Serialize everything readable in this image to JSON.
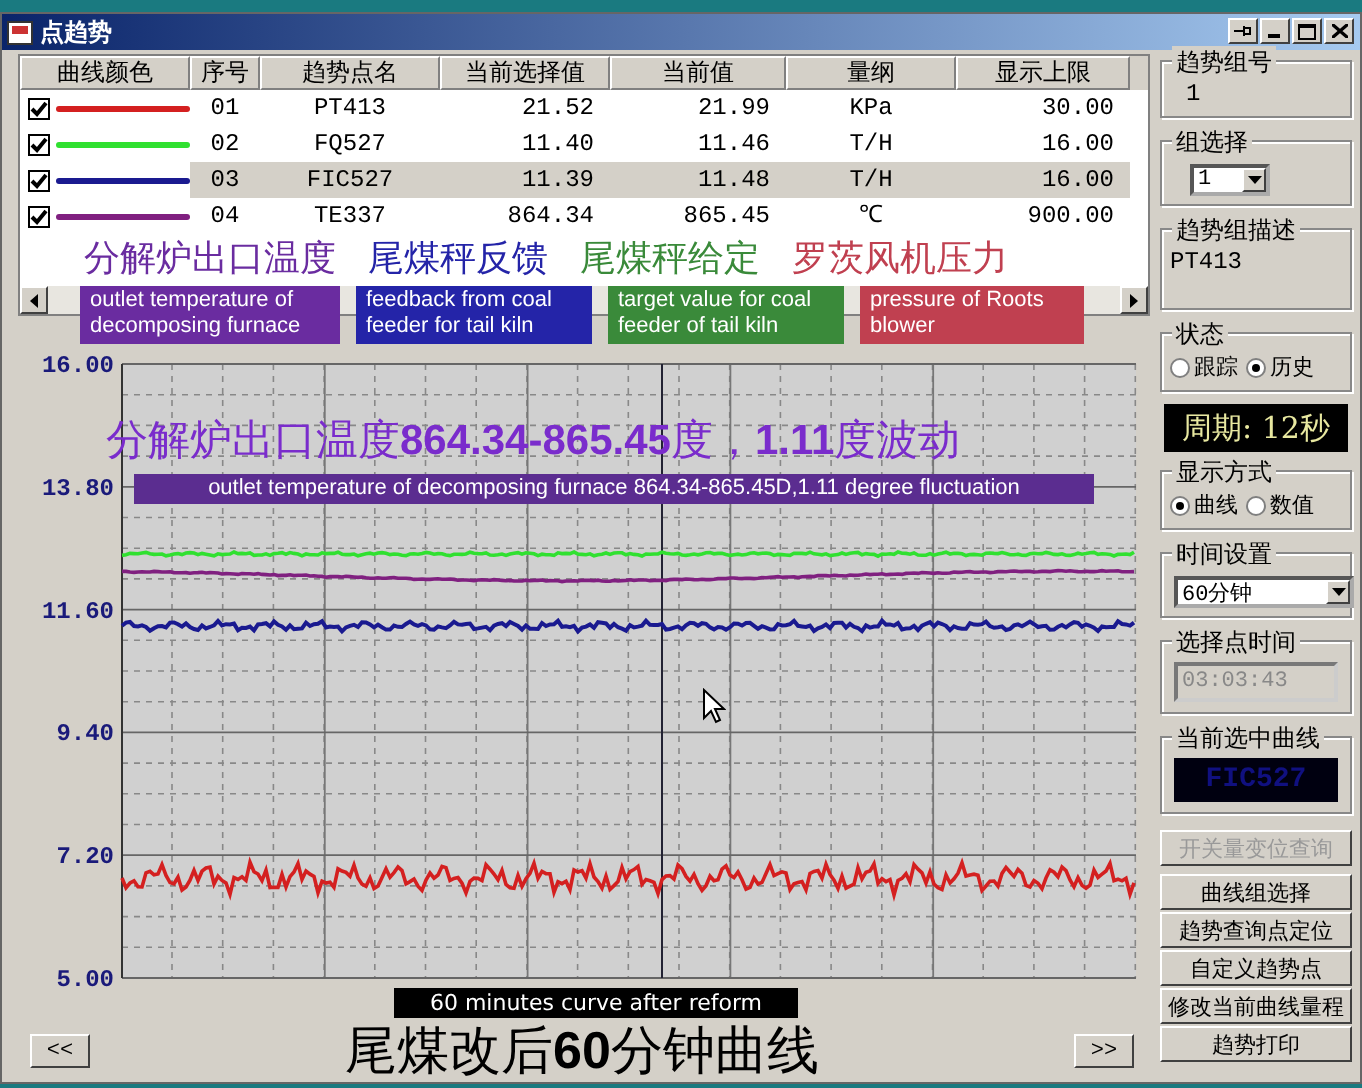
{
  "window": {
    "title": "点趋势"
  },
  "table": {
    "columns": [
      "曲线颜色",
      "序号",
      "趋势点名",
      "当前选择值",
      "当前值",
      "量纲",
      "显示上限"
    ],
    "rows": [
      {
        "checked": true,
        "color": "#d42020",
        "index": "01",
        "name": "PT413",
        "selected_value": "21.52",
        "current_value": "21.99",
        "unit": "KPa",
        "upper_limit": "30.00",
        "selected": false
      },
      {
        "checked": true,
        "color": "#30e030",
        "index": "02",
        "name": "FQ527",
        "selected_value": "11.40",
        "current_value": "11.46",
        "unit": "T/H",
        "upper_limit": "16.00",
        "selected": false
      },
      {
        "checked": true,
        "color": "#1a1a90",
        "index": "03",
        "name": "FIC527",
        "selected_value": "11.39",
        "current_value": "11.48",
        "unit": "T/H",
        "upper_limit": "16.00",
        "selected": true
      },
      {
        "checked": true,
        "color": "#802080",
        "index": "04",
        "name": "TE337",
        "selected_value": "864.34",
        "current_value": "865.45",
        "unit": "℃",
        "upper_limit": "900.00",
        "selected": false
      }
    ]
  },
  "annotations": [
    {
      "label": "分解炉出口温度",
      "english": "outlet temperature of decomposing furnace",
      "color": "#6a2ca0"
    },
    {
      "label": "尾煤秤反馈",
      "english": "feedback from coal feeder for tail kiln",
      "color": "#2424a8"
    },
    {
      "label": "尾煤秤给定",
      "english": "target value for coal feeder of tail kiln",
      "color": "#3a8a3a"
    },
    {
      "label": "罗茨风机压力",
      "english": "pressure of Roots blower",
      "color": "#c04050"
    }
  ],
  "chart": {
    "y_ticks": [
      "16.00",
      "13.80",
      "11.60",
      "9.40",
      "7.20",
      "5.00"
    ],
    "caption": "分解炉出口温度**864.34-865.45**度，**1.11**度波动",
    "caption_english": "outlet temperature of decomposing furnace 864.34-865.45D,1.11 degree fluctuation",
    "footer_english": "60 minutes curve after reform",
    "title": "尾煤改后**60**分钟曲线",
    "prev": "<<",
    "next": ">>"
  },
  "panel": {
    "group_number": {
      "label": "趋势组号",
      "value": "1"
    },
    "group_select": {
      "label": "组选择",
      "value": "1"
    },
    "group_description": {
      "label": "趋势组描述",
      "value": "PT413"
    },
    "state": {
      "label": "状态",
      "options": [
        {
          "label": "跟踪",
          "selected": false
        },
        {
          "label": "历史",
          "selected": true
        }
      ]
    },
    "period": "周期: 12秒",
    "display_mode": {
      "label": "显示方式",
      "options": [
        {
          "label": "曲线",
          "selected": true
        },
        {
          "label": "数值",
          "selected": false
        }
      ]
    },
    "time_setting": {
      "label": "时间设置",
      "value": "60分钟"
    },
    "selected_time": {
      "label": "选择点时间",
      "value": "03:03:43",
      "disabled": true
    },
    "selected_curve": {
      "label": "当前选中曲线",
      "value": "FIC527"
    },
    "buttons": [
      {
        "label": "开关量变位查询",
        "disabled": true
      },
      {
        "label": "曲线组选择",
        "disabled": false
      },
      {
        "label": "趋势查询点定位",
        "disabled": false
      },
      {
        "label": "自定义趋势点",
        "disabled": false
      },
      {
        "label": "修改当前曲线量程",
        "disabled": false
      },
      {
        "label": "趋势打印",
        "disabled": false
      }
    ]
  }
}
